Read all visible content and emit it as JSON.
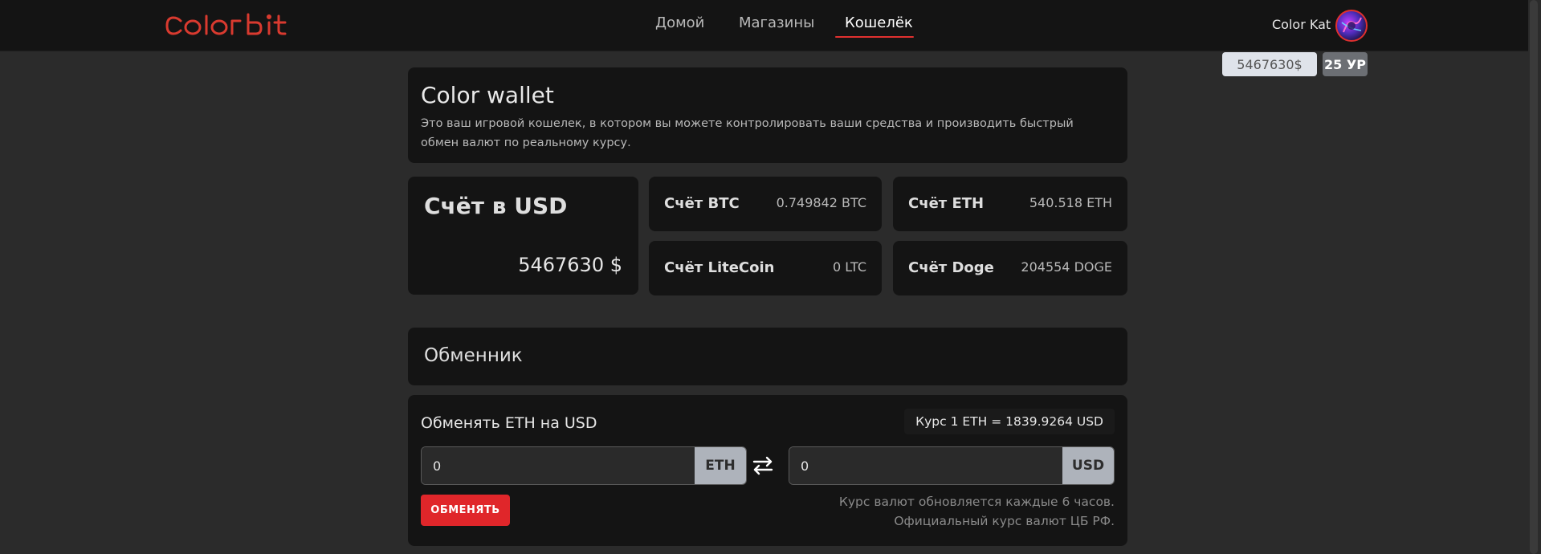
{
  "brand": {
    "logo_text": "COLOR bit"
  },
  "nav": {
    "items": [
      {
        "label": "Домой",
        "active": false
      },
      {
        "label": "Магазины",
        "active": false
      },
      {
        "label": "Кошелёк",
        "active": true
      }
    ]
  },
  "user": {
    "name": "Color Kat",
    "balance_label": "5467630$",
    "level_label": "25 УР"
  },
  "wallet": {
    "title": "Color wallet",
    "description": "Это ваш игровой кошелек, в котором вы можете контролировать ваши средства и производить быстрый обмен валют по реальному курсу."
  },
  "accounts": {
    "usd": {
      "title": "Счёт в USD",
      "value": "5467630 $"
    },
    "btc": {
      "name": "Счёт BTC",
      "value": "0.749842 BTC"
    },
    "eth": {
      "name": "Счёт ETH",
      "value": "540.518 ETH"
    },
    "ltc": {
      "name": "Счёт LiteCoin",
      "value": "0 LTC"
    },
    "doge": {
      "name": "Счёт Doge",
      "value": "204554 DOGE"
    }
  },
  "exchanger": {
    "title": "Обменник",
    "form_title": "Обменять ETH на USD",
    "rate": "Курс 1 ETH = 1839.9264 USD",
    "from_value": "0",
    "from_currency": "ETH",
    "to_value": "0",
    "to_currency": "USD",
    "button_label": "ОБМЕНЯТЬ",
    "note_update": "Курс валют обновляется каждые 6 часов.",
    "note_official": "Официальный курс валют ЦБ РФ."
  },
  "colors": {
    "accent": "#e0302f",
    "background": "#2b2b2b",
    "card": "#141414"
  }
}
